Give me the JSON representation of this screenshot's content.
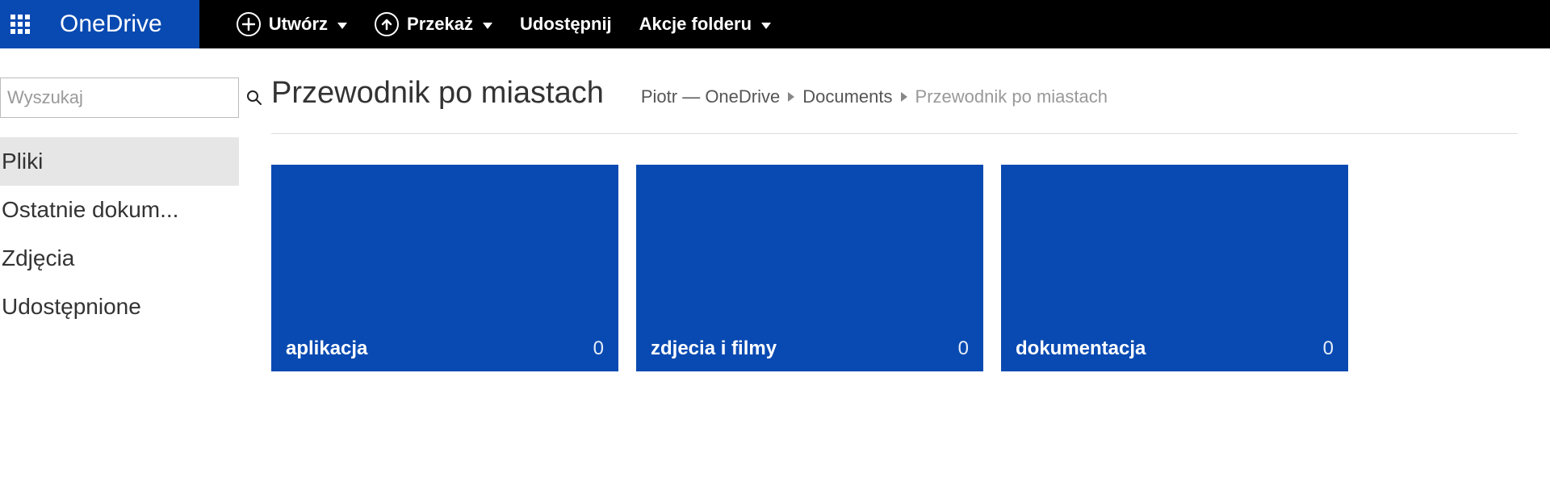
{
  "header": {
    "brand": "OneDrive",
    "actions": {
      "create": "Utwórz",
      "upload": "Przekaż",
      "share": "Udostępnij",
      "folder_actions": "Akcje folderu"
    }
  },
  "search": {
    "placeholder": "Wyszukaj"
  },
  "sidebar": {
    "items": [
      {
        "label": "Pliki",
        "active": true
      },
      {
        "label": "Ostatnie dokum...",
        "active": false
      },
      {
        "label": "Zdjęcia",
        "active": false
      },
      {
        "label": "Udostępnione",
        "active": false
      }
    ]
  },
  "content": {
    "title": "Przewodnik po miastach",
    "breadcrumb": {
      "root": "Piotr — OneDrive",
      "segments": [
        "Documents",
        "Przewodnik po miastach"
      ]
    },
    "tiles": [
      {
        "name": "aplikacja",
        "count": "0"
      },
      {
        "name": "zdjecia i filmy",
        "count": "0"
      },
      {
        "name": "dokumentacja",
        "count": "0"
      }
    ]
  }
}
